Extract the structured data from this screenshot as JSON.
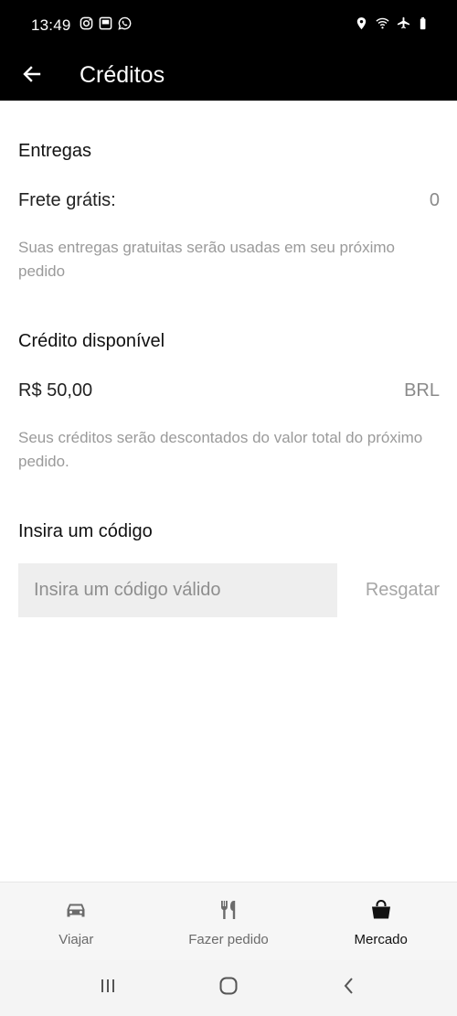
{
  "status_bar": {
    "time": "13:49",
    "left_icons": [
      "instagram-icon",
      "gallery-icon",
      "whatsapp-icon"
    ],
    "right_icons": [
      "location-icon",
      "wifi-icon",
      "airplane-icon",
      "battery-icon"
    ]
  },
  "header": {
    "title": "Créditos",
    "back_icon": "arrow-left-icon"
  },
  "sections": {
    "entregas": {
      "title": "Entregas",
      "label": "Frete grátis:",
      "value": "0",
      "hint": "Suas entregas gratuitas serão usadas em seu próximo pedido"
    },
    "credito": {
      "title": "Crédito disponível",
      "label": "R$ 50,00",
      "value": "BRL",
      "hint": "Seus créditos serão descontados do valor total do próximo pedido."
    },
    "codigo": {
      "title": "Insira um código",
      "placeholder": "Insira um código válido",
      "redeem_label": "Resgatar"
    }
  },
  "tabs": [
    {
      "label": "Viajar",
      "icon": "car-icon",
      "active": false
    },
    {
      "label": "Fazer pedido",
      "icon": "fork-knife-icon",
      "active": false
    },
    {
      "label": "Mercado",
      "icon": "shopping-bag-icon",
      "active": true
    }
  ],
  "colors": {
    "header_bg": "#000000",
    "hint_text": "#9a9a9a",
    "input_bg": "#eeeeee",
    "tab_bar_bg": "#f6f6f6"
  }
}
